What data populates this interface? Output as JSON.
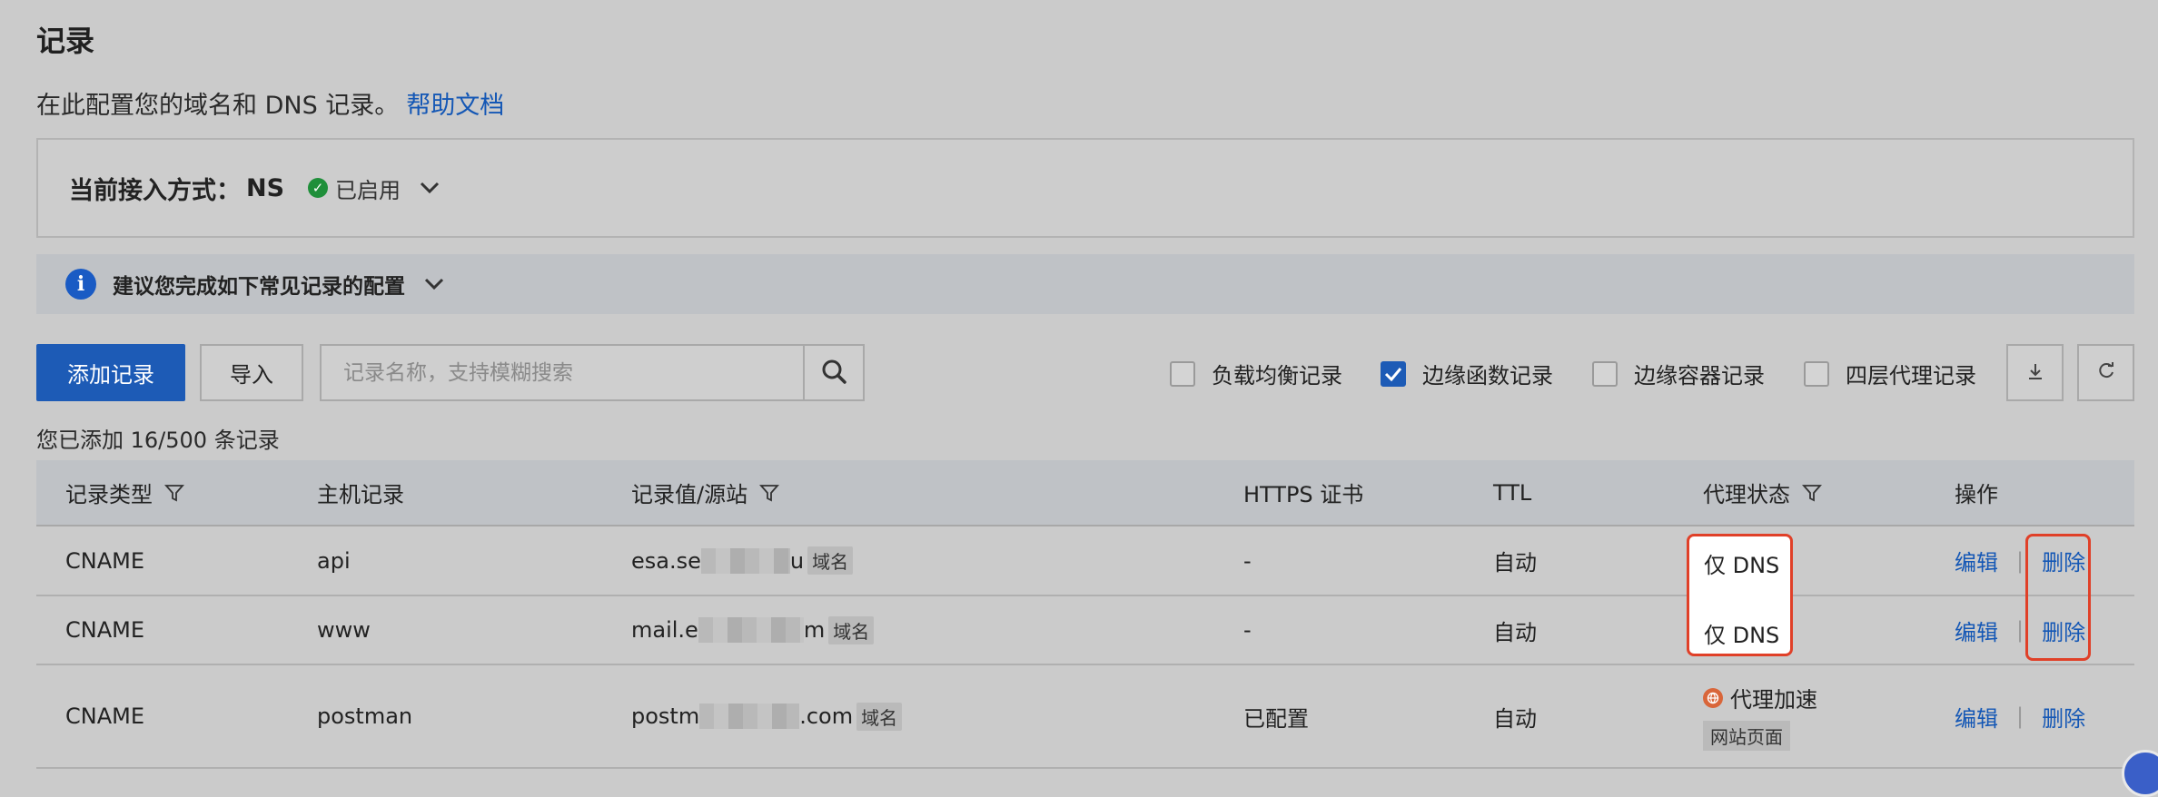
{
  "page": {
    "title": "记录",
    "description": "在此配置您的域名和 DNS 记录。",
    "help_link": "帮助文档"
  },
  "access": {
    "label": "当前接入方式：",
    "value": "NS",
    "status": "已启用"
  },
  "tip": {
    "text": "建议您完成如下常见记录的配置"
  },
  "toolbar": {
    "add_label": "添加记录",
    "import_label": "导入",
    "search_placeholder": "记录名称，支持模糊搜索",
    "filters": [
      {
        "label": "负载均衡记录",
        "checked": false
      },
      {
        "label": "边缘函数记录",
        "checked": true
      },
      {
        "label": "边缘容器记录",
        "checked": false
      },
      {
        "label": "四层代理记录",
        "checked": false
      }
    ]
  },
  "summary": {
    "count_text": "您已添加 16/500 条记录"
  },
  "table": {
    "columns": [
      "记录类型",
      "主机记录",
      "记录值/源站",
      "HTTPS 证书",
      "TTL",
      "代理状态",
      "操作"
    ],
    "rows": [
      {
        "type": "CNAME",
        "host": "api",
        "value_prefix": "esa.se",
        "value_suffix": "u",
        "value_tag": "域名",
        "https": "-",
        "ttl": "自动",
        "proxy": "仅 DNS",
        "proxy_sub": "",
        "edit": "编辑",
        "delete": "删除"
      },
      {
        "type": "CNAME",
        "host": "www",
        "value_prefix": "mail.e",
        "value_suffix": "m",
        "value_tag": "域名",
        "https": "-",
        "ttl": "自动",
        "proxy": "仅 DNS",
        "proxy_sub": "",
        "edit": "编辑",
        "delete": "删除"
      },
      {
        "type": "CNAME",
        "host": "postman",
        "value_prefix": "postm",
        "value_suffix": ".com",
        "value_tag": "域名",
        "https": "已配置",
        "ttl": "自动",
        "proxy": "代理加速",
        "proxy_sub": "网站页面",
        "edit": "编辑",
        "delete": "删除"
      }
    ]
  },
  "colors": {
    "primary": "#1d5bb6",
    "link": "#1457b5",
    "success": "#1f8f3a",
    "highlight": "#e04028"
  }
}
